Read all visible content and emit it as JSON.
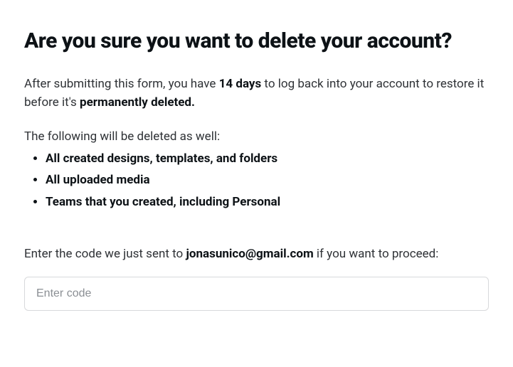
{
  "heading": "Are you sure you want to delete your account?",
  "intro": {
    "before": "After submitting this form, you have ",
    "days": "14 days",
    "middle": " to log back into your account to restore it before it's ",
    "permanent": "permanently deleted."
  },
  "list_intro": "The following will be deleted as well:",
  "bullets": [
    "All created designs, templates, and folders",
    "All uploaded media",
    "Teams that you created, including Personal"
  ],
  "prompt": {
    "before": "Enter the code we just sent to ",
    "email": "jonasunico@gmail.com",
    "after": " if you want to proceed:"
  },
  "code_input": {
    "placeholder": "Enter code",
    "value": ""
  }
}
